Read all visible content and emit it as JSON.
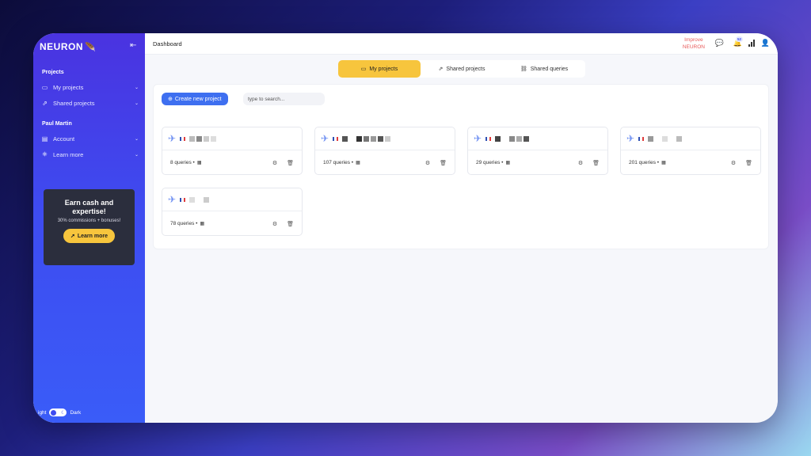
{
  "app": {
    "logo": "NEURON"
  },
  "sidebar": {
    "projects_label": "Projects",
    "items": [
      {
        "label": "My projects",
        "icon": "folder-icon"
      },
      {
        "label": "Shared projects",
        "icon": "share-icon"
      }
    ],
    "user_name": "Paul Martin",
    "user_items": [
      {
        "label": "Account",
        "icon": "id-card-icon"
      },
      {
        "label": "Learn more",
        "icon": "gift-icon"
      }
    ],
    "promo": {
      "title": "Earn cash and expertise!",
      "subtitle": "30% commissions + bonuses!",
      "button": "Learn more"
    },
    "theme": {
      "light": "ight",
      "dark": "Dark"
    }
  },
  "topbar": {
    "title": "Dashboard",
    "improve_line1": "Improve",
    "improve_line2": "NEURON",
    "notif_count": "52"
  },
  "tabs": [
    {
      "label": "My projects",
      "active": true
    },
    {
      "label": "Shared projects",
      "active": false
    },
    {
      "label": "Shared queries",
      "active": false
    }
  ],
  "toolbar": {
    "create_label": "Create new project",
    "search_placeholder": "type to search..."
  },
  "projects": [
    {
      "queries": "8 queries •"
    },
    {
      "queries": "107 queries •"
    },
    {
      "queries": "29 queries •"
    },
    {
      "queries": "201 queries •"
    },
    {
      "queries": "78 queries •"
    }
  ],
  "colors": {
    "accent": "#3e4bf0",
    "tab_active": "#f7c53d",
    "improve": "#e85a5a"
  }
}
